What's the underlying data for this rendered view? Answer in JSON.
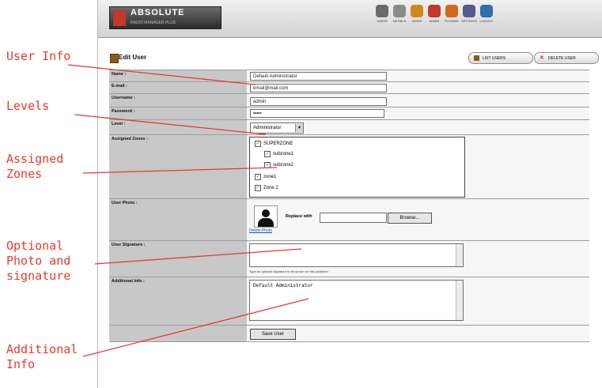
{
  "annotations": {
    "user_info": "User Info",
    "levels": "Levels",
    "assigned_zones": "Assigned\nZones",
    "photo_signature": "Optional\nPhoto and\nsignature",
    "additional_info": "Additional\nInfo",
    "color": "#e8392c"
  },
  "header": {
    "logo_text": "ABSOLUTE",
    "logo_subtext": "RADIO MANAGER PLUS",
    "nav": [
      {
        "icon": "users-icon",
        "label": "USERS",
        "color": "#6b6b6b"
      },
      {
        "icon": "zones-icon",
        "label": "DETAILS",
        "color": "#8a8a8a"
      },
      {
        "icon": "stats-icon",
        "label": "VIEWS",
        "color": "#d08a1a"
      },
      {
        "icon": "banners-icon",
        "label": "ADMIN",
        "color": "#c0392b"
      },
      {
        "icon": "publishers-icon",
        "label": "PLUGINS",
        "color": "#d2691e"
      },
      {
        "icon": "settings-icon",
        "label": "SETTINGS",
        "color": "#5a5a8a"
      },
      {
        "icon": "logout-icon",
        "label": "LOGOUT",
        "color": "#2f6fb0"
      }
    ]
  },
  "page": {
    "title": "Edit User",
    "list_users_label": "LIST USERS",
    "delete_user_label": "DELETE USER"
  },
  "form": {
    "name": {
      "label": "Name :",
      "value": "Default Administrator"
    },
    "email": {
      "label": "E-mail :",
      "value": "email@mail.com"
    },
    "username": {
      "label": "Username :",
      "value": "admin"
    },
    "password": {
      "label": "Password :",
      "value": "•••••"
    },
    "level": {
      "label": "Level :",
      "value": "Administrator"
    },
    "zones": {
      "label": "Assigned Zones :",
      "items": [
        {
          "name": "SUPERZONE",
          "checked": true
        },
        {
          "name": "subzone1",
          "checked": true
        },
        {
          "name": "subzone2",
          "checked": true
        },
        {
          "name": "zone1",
          "checked": true
        },
        {
          "name": "Zone 2",
          "checked": true
        }
      ]
    },
    "photo": {
      "label": "User Photo :",
      "delete_link": "Delete Photo",
      "replace_label": "Replace with",
      "browse_label": "Browse..."
    },
    "signature": {
      "label": "User Signature :",
      "hint": "Type an optional signature to be shown for this publisher"
    },
    "additional": {
      "label": "Additional Info :",
      "value": "Default Administrator"
    },
    "save_label": "Save User"
  }
}
